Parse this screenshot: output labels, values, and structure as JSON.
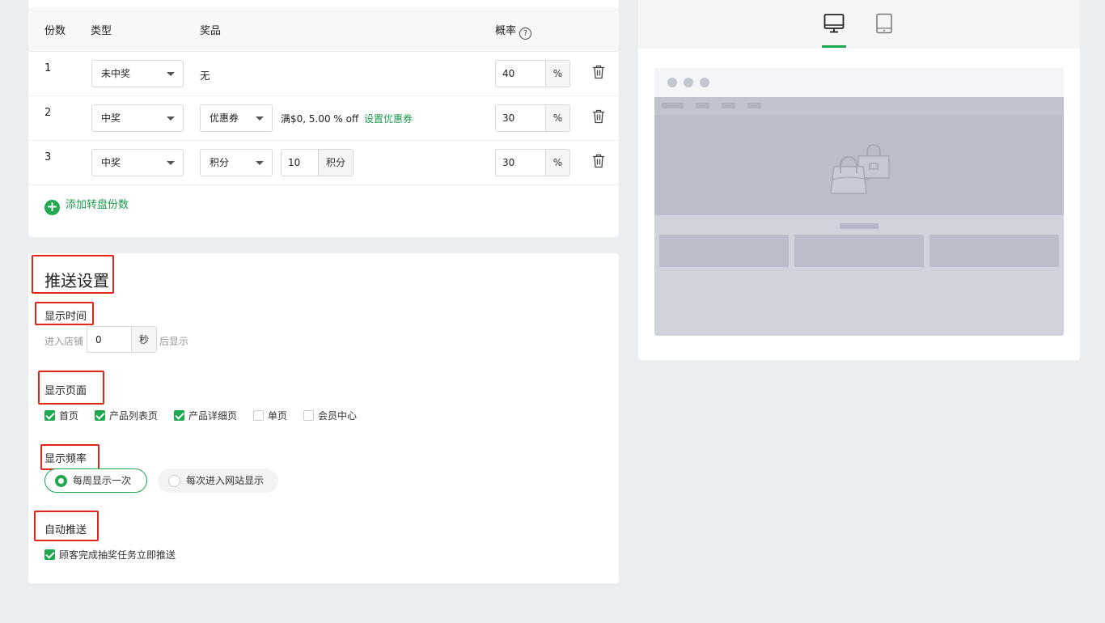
{
  "prize_table": {
    "headers": {
      "index": "份数",
      "type": "类型",
      "prize": "奖品",
      "probability": "概率",
      "help": "?"
    },
    "rows": [
      {
        "index": "1",
        "type": "未中奖",
        "prize_text": "无",
        "probability": "40",
        "unit": "%"
      },
      {
        "index": "2",
        "type": "中奖",
        "prize_kind": "优惠券",
        "coupon_desc": "满$0,  5.00 % off",
        "coupon_link": "设置优惠券",
        "probability": "30",
        "unit": "%"
      },
      {
        "index": "3",
        "type": "中奖",
        "prize_kind": "积分",
        "points_value": "10",
        "points_unit": "积分",
        "probability": "30",
        "unit": "%"
      }
    ],
    "add_label": "添加转盘份数"
  },
  "push_settings": {
    "title": "推送设置",
    "display_time": {
      "label": "显示时间",
      "prefix": "进入店铺",
      "value": "0",
      "unit": "秒",
      "suffix": "后显示"
    },
    "display_pages": {
      "label": "显示页面",
      "options": [
        {
          "label": "首页",
          "checked": true
        },
        {
          "label": "产品列表页",
          "checked": true
        },
        {
          "label": "产品详细页",
          "checked": true
        },
        {
          "label": "单页",
          "checked": false
        },
        {
          "label": "会员中心",
          "checked": false
        }
      ]
    },
    "display_frequency": {
      "label": "显示频率",
      "options": [
        {
          "label": "每周显示一次",
          "selected": true
        },
        {
          "label": "每次进入网站显示",
          "selected": false
        }
      ]
    },
    "auto_push": {
      "label": "自动推送",
      "option": "顾客完成抽奖任务立即推送",
      "checked": true
    }
  },
  "preview": {
    "tabs": [
      {
        "name": "desktop",
        "icon": "monitor-icon",
        "active": true
      },
      {
        "name": "mobile",
        "icon": "tablet-icon",
        "active": false
      }
    ]
  },
  "colors": {
    "accent": "#1fa850",
    "highlight": "#e0251b",
    "background": "#ebeef1"
  }
}
